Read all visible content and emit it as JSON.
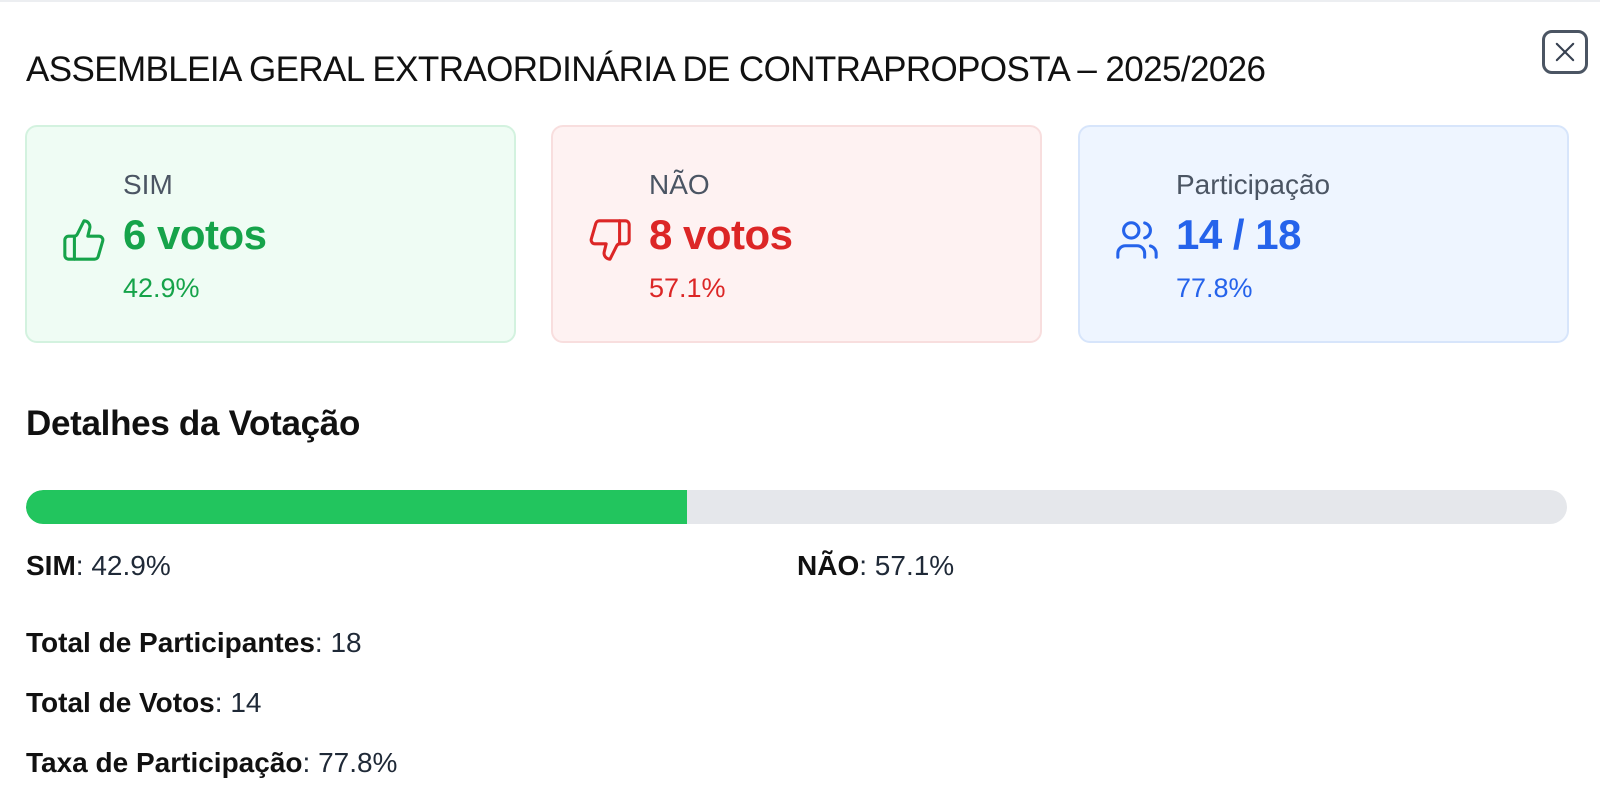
{
  "modal": {
    "title": "ASSEMBLEIA GERAL EXTRAORDINÁRIA DE CONTRAPROPOSTA – 2025/2026",
    "close_icon": "close-icon"
  },
  "cards": {
    "sim": {
      "label": "SIM",
      "value": "6 votos",
      "percent": "42.9%",
      "icon": "thumbs-up-icon",
      "color": "#16a34a"
    },
    "nao": {
      "label": "NÃO",
      "value": "8 votos",
      "percent": "57.1%",
      "icon": "thumbs-down-icon",
      "color": "#dc2626"
    },
    "participacao": {
      "label": "Participação",
      "value": "14 / 18",
      "percent": "77.8%",
      "icon": "users-icon",
      "color": "#2563eb"
    }
  },
  "details": {
    "title": "Detalhes da Votação",
    "progress": {
      "sim_fraction": 0.429,
      "fill_color": "#22c55e",
      "track_color": "#e5e7eb"
    },
    "sim_label": "SIM",
    "sim_value": "42.9%",
    "nao_label": "NÃO",
    "nao_value": "57.1%",
    "stats": [
      {
        "label": "Total de Participantes",
        "value": "18"
      },
      {
        "label": "Total de Votos",
        "value": "14"
      },
      {
        "label": "Taxa de Participação",
        "value": "77.8%"
      }
    ]
  }
}
